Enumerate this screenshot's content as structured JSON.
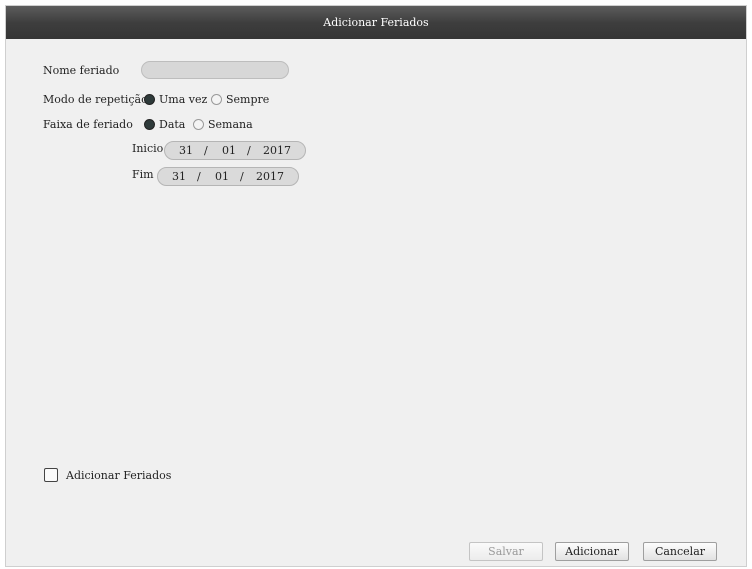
{
  "window": {
    "title": "Adicionar Feriados"
  },
  "form": {
    "name_label": "Nome feriado",
    "name_value": "",
    "repeat_label": "Modo de repetição",
    "repeat_options": [
      "Uma vez",
      "Sempre"
    ],
    "repeat_selected": "Uma vez",
    "range_label": "Faixa de feriado",
    "range_options": [
      "Data",
      "Semana"
    ],
    "range_selected": "Data",
    "start_label": "Inicio",
    "start_date": {
      "day": "31",
      "month": "01",
      "year": "2017"
    },
    "end_label": "Fim",
    "end_date": {
      "day": "31",
      "month": "01",
      "year": "2017"
    },
    "date_separator": "/"
  },
  "footer": {
    "checkbox_label": "Adicionar Feriados",
    "checkbox_checked": false,
    "buttons": {
      "save": "Salvar",
      "add": "Adicionar",
      "cancel": "Cancelar"
    }
  }
}
